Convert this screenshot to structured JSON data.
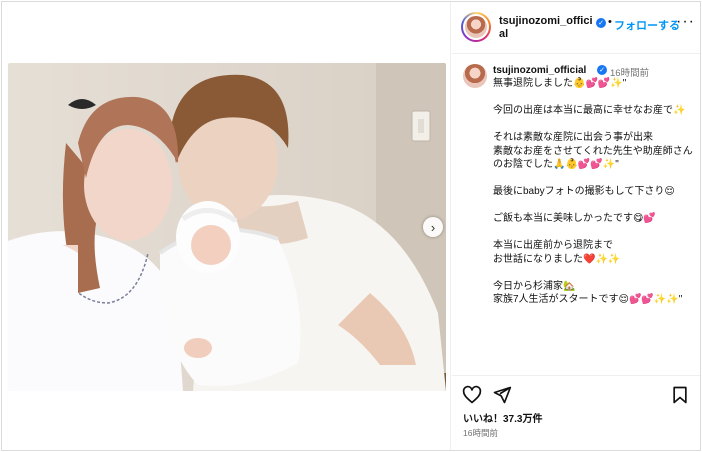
{
  "header": {
    "username": "tsujinozomi_official",
    "follow_label": "フォローする",
    "dot": "•",
    "more": "···"
  },
  "caption": {
    "username": "tsujinozomi_official",
    "time": "16時間前",
    "text": "無事退院しました👶💕💕✨\"\n\n今回の出産は本当に最高に幸せなお産で✨\n\nそれは素敵な産院に出会う事が出来\n素敵なお産をさせてくれた先生や助産師さん\nのお陰でした🙏👶💕💕✨\"\n\n最後にbabyフォトの撮影もして下さり😌\n\nご飯も本当に美味しかったです😋💕\n\n本当に出産前から退院まで\nお世話になりました❤️✨✨\n\n今日から杉浦家🏡\n家族7人生活がスタートです😌💕💕✨✨\""
  },
  "actions": {
    "likes": "いいね！37.3万件",
    "timestamp": "16時間前"
  },
  "media": {
    "next_glyph": "›"
  },
  "colors": {
    "accent": "#0095f6",
    "verified": "#1877f2",
    "muted": "#737373"
  }
}
